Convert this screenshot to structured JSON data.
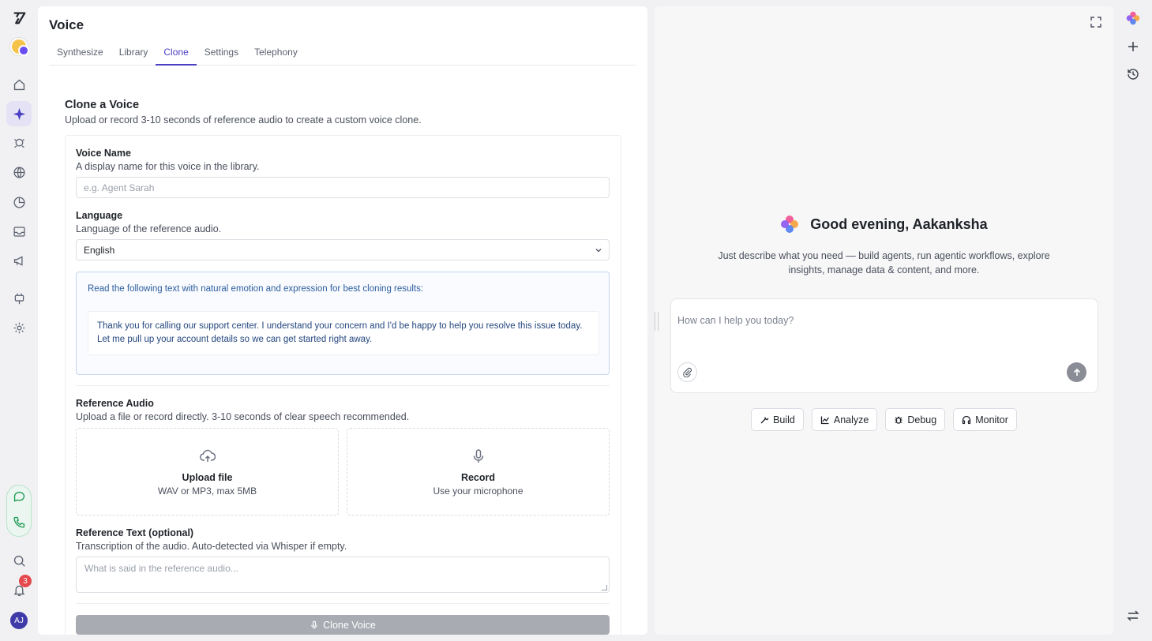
{
  "app": {
    "logo": "Y",
    "brand_color": "#4b3fc4"
  },
  "rail": {
    "items": [
      {
        "icon": "home-icon"
      },
      {
        "icon": "sparkle-icon",
        "active": true
      },
      {
        "icon": "agent-icon"
      },
      {
        "icon": "globe-icon"
      },
      {
        "icon": "analytics-icon"
      },
      {
        "icon": "inbox-icon"
      },
      {
        "icon": "megaphone-icon"
      },
      {
        "icon": "plug-icon"
      },
      {
        "icon": "settings-icon"
      }
    ],
    "notifications_count": "3",
    "user_initials": "AJ"
  },
  "page": {
    "title": "Voice",
    "tabs": [
      {
        "label": "Synthesize"
      },
      {
        "label": "Library"
      },
      {
        "label": "Clone",
        "active": true
      },
      {
        "label": "Settings"
      },
      {
        "label": "Telephony"
      }
    ]
  },
  "clone": {
    "title": "Clone a Voice",
    "subtitle": "Upload or record 3-10 seconds of reference audio to create a custom voice clone.",
    "voice_name": {
      "label": "Voice Name",
      "hint": "A display name for this voice in the library.",
      "placeholder": "e.g. Agent Sarah",
      "value": ""
    },
    "language": {
      "label": "Language",
      "hint": "Language of the reference audio.",
      "value": "English"
    },
    "script": {
      "instruction": "Read the following text with natural emotion and expression for best cloning results:",
      "text": "Thank you for calling our support center. I understand your concern and I'd be happy to help you resolve this issue today. Let me pull up your account details so we can get started right away."
    },
    "reference_audio": {
      "label": "Reference Audio",
      "hint": "Upload a file or record directly. 3-10 seconds of clear speech recommended.",
      "upload_title": "Upload file",
      "upload_sub": "WAV or MP3, max 5MB",
      "record_title": "Record",
      "record_sub": "Use your microphone"
    },
    "reference_text": {
      "label": "Reference Text (optional)",
      "hint": "Transcription of the audio. Auto-detected via Whisper if empty.",
      "placeholder": "What is said in the reference audio..."
    },
    "submit_label": "Clone Voice"
  },
  "assistant": {
    "greeting": "Good evening, Aakanksha",
    "description": "Just describe what you need — build agents, run agentic workflows, explore insights, manage data & content, and more.",
    "input_placeholder": "How can I help you today?",
    "chips": [
      {
        "label": "Build",
        "icon": "wrench-icon"
      },
      {
        "label": "Analyze",
        "icon": "chart-line-icon"
      },
      {
        "label": "Debug",
        "icon": "bug-icon"
      },
      {
        "label": "Monitor",
        "icon": "headphones-icon"
      }
    ]
  },
  "right_rail": {
    "items": [
      {
        "icon": "assistant-logo-icon"
      },
      {
        "icon": "plus-icon"
      },
      {
        "icon": "history-icon"
      },
      {
        "icon": "swap-icon"
      }
    ]
  }
}
